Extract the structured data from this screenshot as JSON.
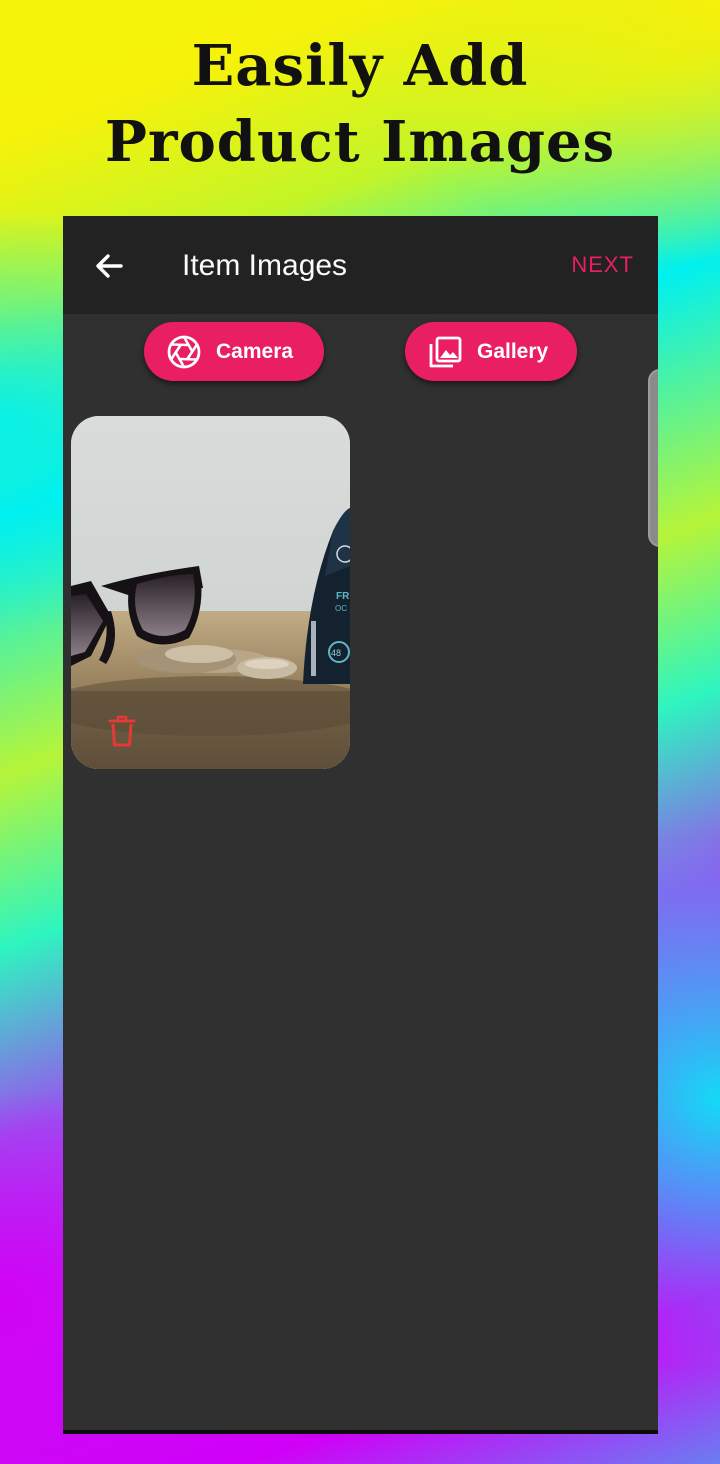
{
  "headline": {
    "line1": "Easily Add",
    "line2": "Product Images"
  },
  "appbar": {
    "title": "Item Images",
    "next_label": "NEXT"
  },
  "actions": {
    "camera_label": "Camera",
    "gallery_label": "Gallery"
  },
  "colors": {
    "accent": "#e91e63",
    "appbar": "#222222",
    "screen": "#303030",
    "trash": "#e53935"
  },
  "icons": {
    "back": "arrow-left-icon",
    "camera": "aperture-icon",
    "gallery": "photo-library-icon",
    "delete": "trash-icon"
  }
}
